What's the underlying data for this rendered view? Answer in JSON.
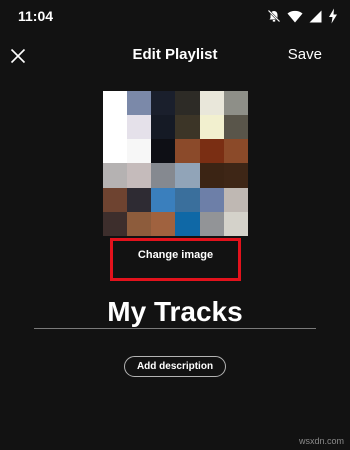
{
  "status_bar": {
    "time": "11:04",
    "icons": [
      "mute-icon",
      "wifi-icon",
      "cellular-signal-icon",
      "battery-charging-icon"
    ]
  },
  "header": {
    "close_icon": "close-icon",
    "title": "Edit Playlist",
    "save_label": "Save"
  },
  "cover": {
    "description_colors": [
      "#ffffff",
      "#7b89a9",
      "#1a1f2c",
      "#2d2b26",
      "#e9e7da",
      "#8e8f88",
      "#ffffff",
      "#e5e1ea",
      "#151a25",
      "#3c3527",
      "#f2f0cf",
      "#59554a",
      "#ffffff",
      "#f7f7f7",
      "#0e0f15",
      "#8b4a2a",
      "#7a2e13",
      "#8b4a29",
      "#b5b2b2",
      "#c5bbbb",
      "#858990",
      "#91a4b8",
      "#3b2414",
      "#3e2616",
      "#6e4330",
      "#2e2b33",
      "#3a7fbd",
      "#3a6f9c",
      "#6d7fa8",
      "#bfb8b3",
      "#3d2e2c",
      "#8d5c3c",
      "#a0623f",
      "#0f68a6",
      "#929497",
      "#d4d2ca"
    ]
  },
  "change_image": {
    "label": "Change image",
    "highlight_color": "#e3121c"
  },
  "playlist": {
    "name": "My Tracks"
  },
  "description_button": {
    "label": "Add description"
  },
  "watermark": "wsxdn.com",
  "colors": {
    "background": "#121212",
    "text": "#ffffff",
    "underline": "#7a7a7a"
  }
}
